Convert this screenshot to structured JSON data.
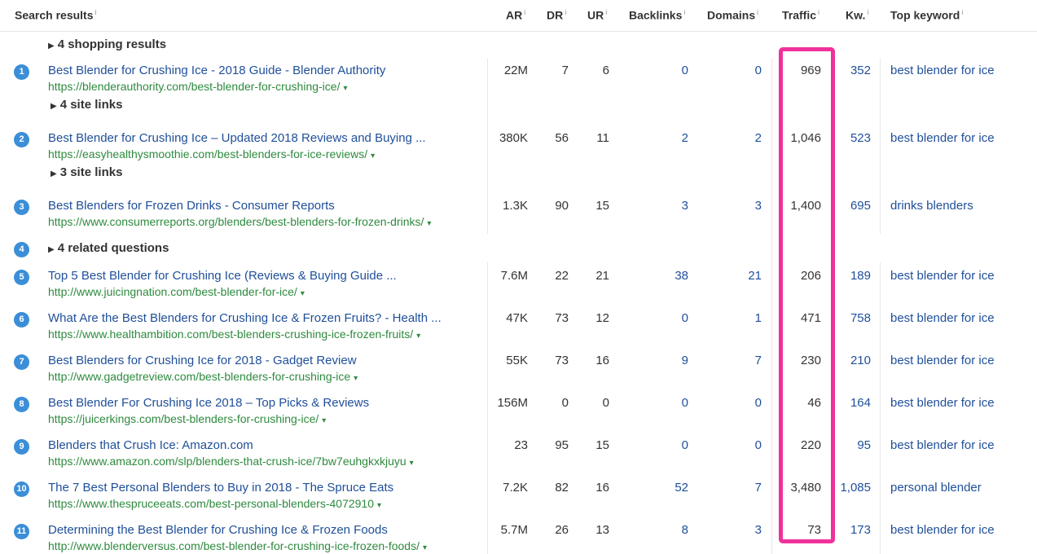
{
  "header": {
    "search_results": "Search results",
    "ar": "AR",
    "dr": "DR",
    "ur": "UR",
    "backlinks": "Backlinks",
    "domains": "Domains",
    "traffic": "Traffic",
    "kw": "Kw.",
    "top_keyword": "Top keyword",
    "info_glyph": "i"
  },
  "groups": {
    "shopping": "4 shopping results",
    "sitelinks_1": "4 site links",
    "sitelinks_2": "3 site links",
    "related": "4 related questions"
  },
  "rank_related": "4",
  "caret": "▾",
  "triangle": "▶",
  "results": [
    {
      "rank": "1",
      "title": "Best Blender for Crushing Ice - 2018 Guide - Blender Authority",
      "url": "https://blenderauthority.com/best-blender-for-crushing-ice/",
      "ar": "22M",
      "dr": "7",
      "ur": "6",
      "backlinks": "0",
      "domains": "0",
      "traffic": "969",
      "kw": "352",
      "top_keyword": "best blender for ice"
    },
    {
      "rank": "2",
      "title": "Best Blender for Crushing Ice – Updated 2018 Reviews and Buying ...",
      "url": "https://easyhealthysmoothie.com/best-blenders-for-ice-reviews/",
      "ar": "380K",
      "dr": "56",
      "ur": "11",
      "backlinks": "2",
      "domains": "2",
      "traffic": "1,046",
      "kw": "523",
      "top_keyword": "best blender for ice"
    },
    {
      "rank": "3",
      "title": "Best Blenders for Frozen Drinks - Consumer Reports",
      "url": "https://www.consumerreports.org/blenders/best-blenders-for-frozen-drinks/",
      "ar": "1.3K",
      "dr": "90",
      "ur": "15",
      "backlinks": "3",
      "domains": "3",
      "traffic": "1,400",
      "kw": "695",
      "top_keyword": "drinks blenders"
    },
    {
      "rank": "5",
      "title": "Top 5 Best Blender for Crushing Ice (Reviews & Buying Guide ...",
      "url": "http://www.juicingnation.com/best-blender-for-ice/",
      "ar": "7.6M",
      "dr": "22",
      "ur": "21",
      "backlinks": "38",
      "domains": "21",
      "traffic": "206",
      "kw": "189",
      "top_keyword": "best blender for ice"
    },
    {
      "rank": "6",
      "title": "What Are the Best Blenders for Crushing Ice & Frozen Fruits? - Health ...",
      "url": "https://www.healthambition.com/best-blenders-crushing-ice-frozen-fruits/",
      "ar": "47K",
      "dr": "73",
      "ur": "12",
      "backlinks": "0",
      "domains": "1",
      "traffic": "471",
      "kw": "758",
      "top_keyword": "best blender for ice"
    },
    {
      "rank": "7",
      "title": "Best Blenders for Crushing Ice for 2018 - Gadget Review",
      "url": "http://www.gadgetreview.com/best-blenders-for-crushing-ice",
      "ar": "55K",
      "dr": "73",
      "ur": "16",
      "backlinks": "9",
      "domains": "7",
      "traffic": "230",
      "kw": "210",
      "top_keyword": "best blender for ice"
    },
    {
      "rank": "8",
      "title": "Best Blender For Crushing Ice 2018 – Top Picks & Reviews",
      "url": "https://juicerkings.com/best-blenders-for-crushing-ice/",
      "ar": "156M",
      "dr": "0",
      "ur": "0",
      "backlinks": "0",
      "domains": "0",
      "traffic": "46",
      "kw": "164",
      "top_keyword": "best blender for ice"
    },
    {
      "rank": "9",
      "title": "Blenders that Crush Ice: Amazon.com",
      "url": "https://www.amazon.com/slp/blenders-that-crush-ice/7bw7euhgkxkjuyu",
      "ar": "23",
      "dr": "95",
      "ur": "15",
      "backlinks": "0",
      "domains": "0",
      "traffic": "220",
      "kw": "95",
      "top_keyword": "best blender for ice"
    },
    {
      "rank": "10",
      "title": "The 7 Best Personal Blenders to Buy in 2018 - The Spruce Eats",
      "url": "https://www.thespruceeats.com/best-personal-blenders-4072910",
      "ar": "7.2K",
      "dr": "82",
      "ur": "16",
      "backlinks": "52",
      "domains": "7",
      "traffic": "3,480",
      "kw": "1,085",
      "top_keyword": "personal blender"
    },
    {
      "rank": "11",
      "title": "Determining the Best Blender for Crushing Ice & Frozen Foods",
      "url": "http://www.blenderversus.com/best-blender-for-crushing-ice-frozen-foods/",
      "ar": "5.7M",
      "dr": "26",
      "ur": "13",
      "backlinks": "8",
      "domains": "3",
      "traffic": "73",
      "kw": "173",
      "top_keyword": "best blender for ice"
    }
  ],
  "colors": {
    "highlight": "#f0319b",
    "link": "#1f4f9a",
    "url": "#2e8a3e",
    "rank_badge": "#3b8ed7"
  }
}
